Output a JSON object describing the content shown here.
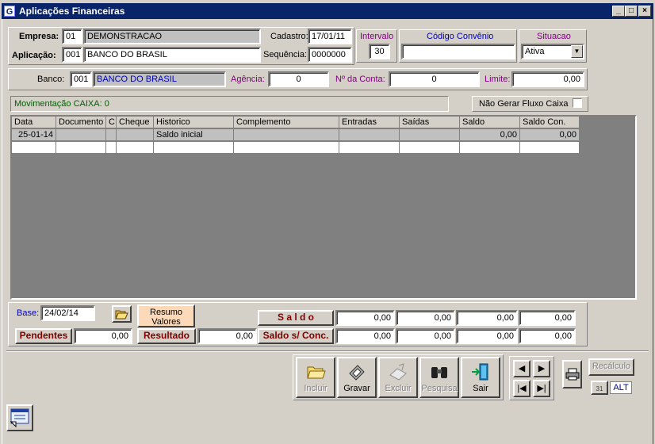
{
  "window": {
    "title": "Aplicações Financeiras",
    "icon_letter": "G",
    "minimize": "_",
    "restore": "□",
    "close": "×"
  },
  "header": {
    "empresa_label": "Empresa:",
    "empresa_code": "01",
    "empresa_name": "DEMONSTRACAO",
    "aplicacao_label": "Aplicação:",
    "aplicacao_code": "001",
    "aplicacao_name": "BANCO DO BRASIL",
    "cadastro_label": "Cadastro:",
    "cadastro_value": "17/01/11",
    "sequencia_label": "Sequência:",
    "sequencia_value": "0000000",
    "intervalo_label": "Intervalo",
    "intervalo_value": "30",
    "convenio_label": "Código Convênio",
    "convenio_value": "",
    "situacao_label": "Situacao",
    "situacao_value": "Ativa"
  },
  "bank": {
    "banco_label": "Banco:",
    "banco_code": "001",
    "banco_name": "BANCO DO BRASIL",
    "agencia_label": "Agência:",
    "agencia_value": "0",
    "conta_label": "Nº da Conta:",
    "conta_value": "0",
    "limite_label": "Limite:",
    "limite_value": "0,00"
  },
  "movimentacao": {
    "label": "Movimentação CAIXA: 0",
    "nao_gerar_label": "Não Gerar Fluxo Caixa",
    "nao_gerar_checked": false
  },
  "table": {
    "columns": [
      "Data",
      "Documento",
      "C",
      "Cheque",
      "Historico",
      "Complemento",
      "Entradas",
      "Saídas",
      "Saldo",
      "Saldo Con."
    ],
    "rows": [
      [
        "25-01-14",
        "",
        "",
        "",
        "Saldo inicial",
        "",
        "",
        "",
        "0,00",
        "0,00"
      ],
      [
        "",
        "",
        "",
        "",
        "",
        "",
        "",
        "",
        "",
        ""
      ]
    ]
  },
  "footer": {
    "base_label": "Base:",
    "base_value": "24/02/14",
    "resumo_label_1": "Resumo",
    "resumo_label_2": "Valores",
    "pendentes_label": "Pendentes",
    "pendentes_value": "0,00",
    "resultado_label": "Resultado",
    "resultado_value": "0,00",
    "saldo_label": "S a l d o",
    "saldo_values": [
      "0,00",
      "0,00",
      "0,00",
      "0,00"
    ],
    "saldo_conc_label": "Saldo s/ Conc.",
    "saldo_conc_values": [
      "0,00",
      "0,00",
      "0,00",
      "0,00"
    ]
  },
  "toolbar": {
    "incluir": "Incluir",
    "gravar": "Gravar",
    "excluir": "Excluir",
    "pesquisa": "Pesquisa",
    "sair": "Sair",
    "recalculo": "Recálculo",
    "alt": "ALT",
    "calendar_glyph": "31"
  },
  "colors": {
    "titlebar": "#0a246a",
    "label_blue": "#0000c0",
    "label_purple": "#800080",
    "label_maroon": "#800000",
    "label_green": "#006000"
  }
}
